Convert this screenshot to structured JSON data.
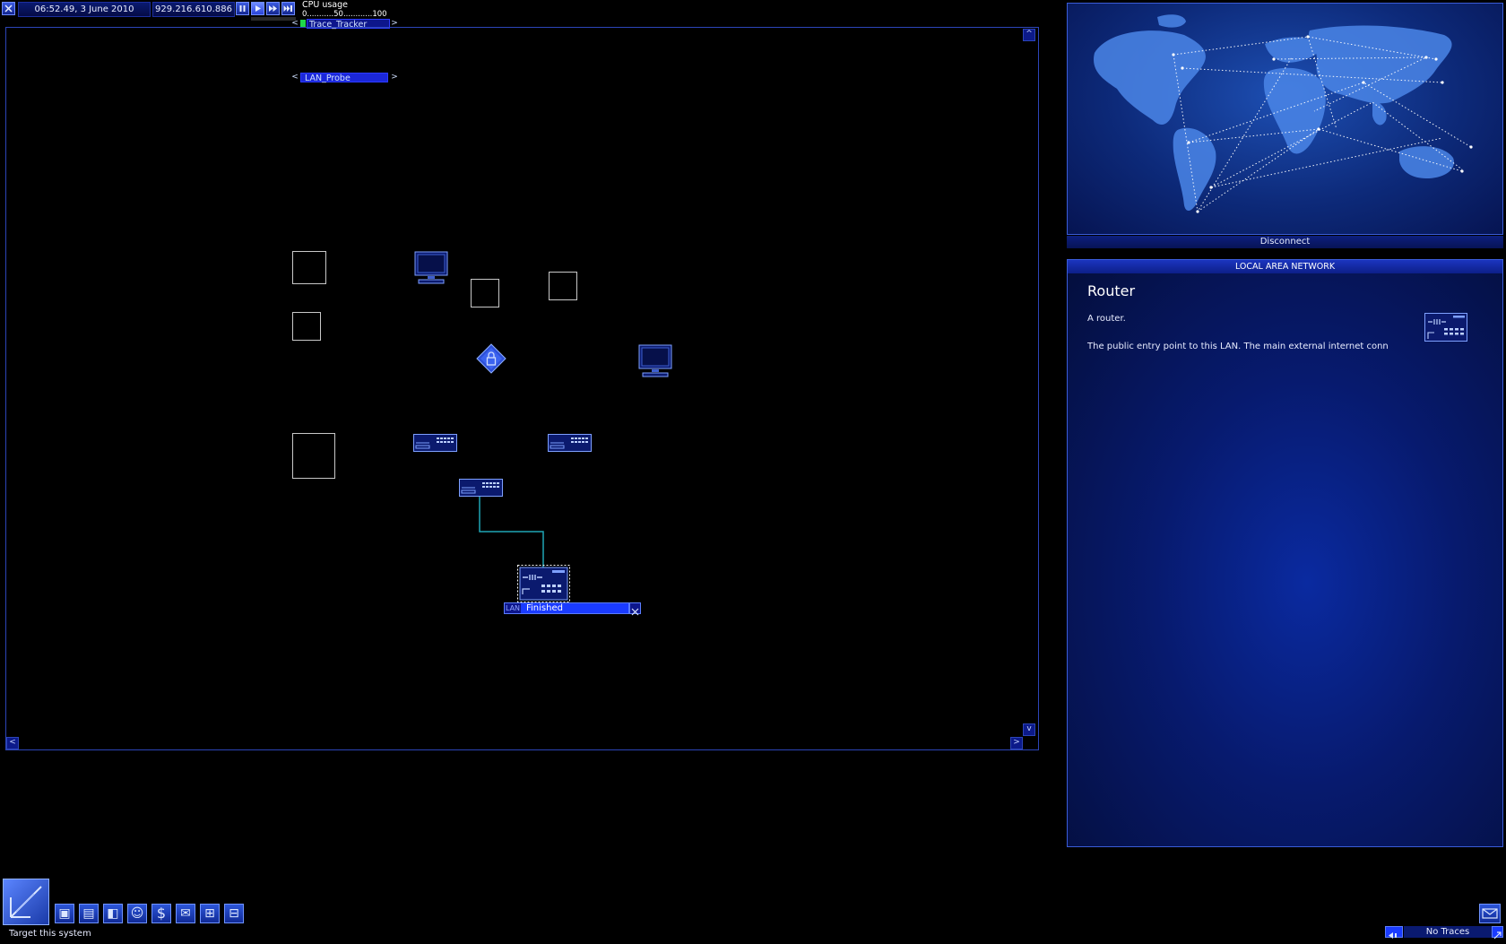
{
  "hud": {
    "time": "06:52.49, 3 June 2010",
    "ip": "929.216.610.886",
    "cpu_label": "CPU usage",
    "cpu_scale": "0...........50............100",
    "cpu_level": 0.12
  },
  "programs": {
    "trace_tracker": "Trace_Tracker",
    "lan_probe": "LAN_Probe",
    "prev_arrow": "<",
    "next_arrow": ">"
  },
  "lan_panel": {
    "scroll_up": "^",
    "scroll_down": "v",
    "scroll_left": "<",
    "scroll_right": ">",
    "status_icon_text": "LAN",
    "status_text": "Finished"
  },
  "map": {
    "disconnect_label": "Disconnect"
  },
  "info": {
    "header": "LOCAL AREA NETWORK",
    "title": "Router",
    "short_desc": "A router.",
    "long_desc": "The public entry point to this LAN. The main external internet conn"
  },
  "footer": {
    "target_label": "Target this system",
    "traces_label": "No Traces"
  },
  "icons": [
    "close-icon",
    "pause-icon",
    "play-icon",
    "fast-forward-icon",
    "fastest-icon",
    "computer-icon",
    "lock-icon",
    "router-icon",
    "world-map-icon",
    "mail-icon",
    "dollar-icon"
  ],
  "colors": {
    "accent": "#1a3bff",
    "panel_border": "#2c45b8",
    "cable": "#1fa5b5"
  }
}
